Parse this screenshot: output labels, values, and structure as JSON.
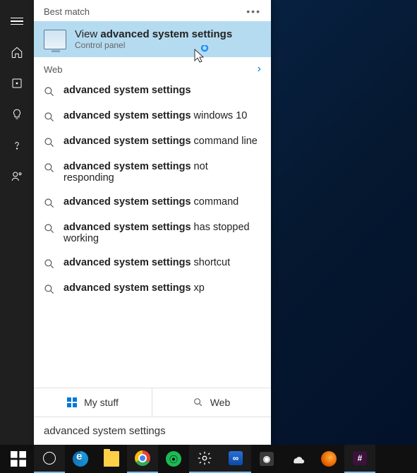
{
  "rail": {
    "items": [
      "menu",
      "home",
      "apps",
      "tips",
      "help",
      "feedback"
    ]
  },
  "sections": {
    "best_match_label": "Best match",
    "web_label": "Web"
  },
  "best_match": {
    "prefix": "View ",
    "bold": "advanced system settings",
    "subtitle": "Control panel"
  },
  "web_results": [
    {
      "bold": "advanced system settings",
      "rest": ""
    },
    {
      "bold": "advanced system settings",
      "rest": " windows 10"
    },
    {
      "bold": "advanced system settings",
      "rest": " command line"
    },
    {
      "bold": "advanced system settings",
      "rest": " not responding"
    },
    {
      "bold": "advanced system settings",
      "rest": " command"
    },
    {
      "bold": "advanced system settings",
      "rest": " has stopped working"
    },
    {
      "bold": "advanced system settings",
      "rest": " shortcut"
    },
    {
      "bold": "advanced system settings",
      "rest": " xp"
    }
  ],
  "tabs": {
    "my_stuff": "My stuff",
    "web": "Web"
  },
  "search_query": "advanced system settings",
  "taskbar": {
    "items": [
      "start",
      "cortana",
      "edge",
      "explorer",
      "chrome",
      "spotify",
      "settings",
      "visual-studio",
      "music",
      "onedrive",
      "firefox",
      "slack"
    ]
  }
}
